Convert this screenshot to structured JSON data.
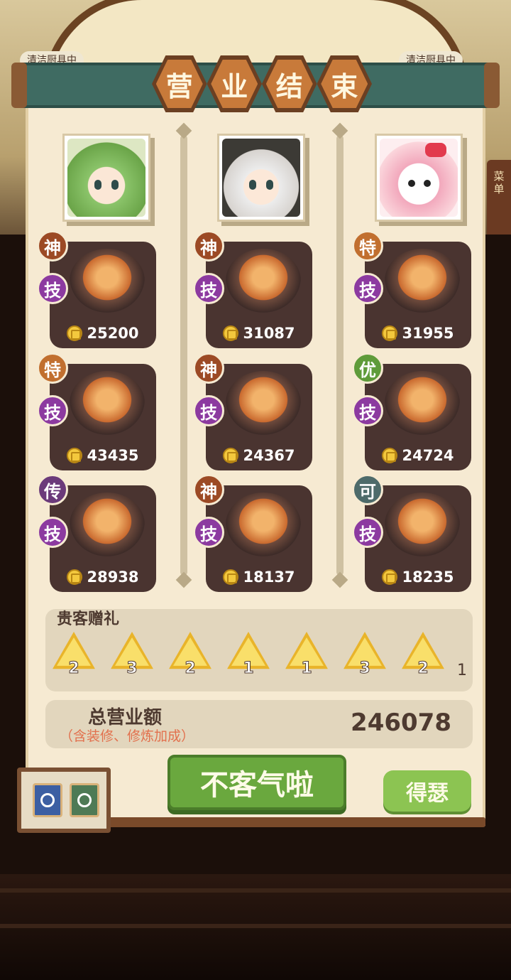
{
  "title_chars": [
    "营",
    "业",
    "结",
    "束"
  ],
  "background": {
    "bubble_left": "清洁厨具中",
    "bubble_right": "清洁厨具中",
    "side_panel": "菜单"
  },
  "customers": [
    {
      "avatar": "green-hair-girl-avatar",
      "dishes": [
        {
          "grade": "神",
          "skill": "技",
          "price": "25200"
        },
        {
          "grade": "特",
          "skill": "技",
          "price": "43435"
        },
        {
          "grade": "传",
          "skill": "技",
          "price": "28938"
        }
      ]
    },
    {
      "avatar": "white-hair-boy-avatar",
      "dishes": [
        {
          "grade": "神",
          "skill": "技",
          "price": "31087"
        },
        {
          "grade": "神",
          "skill": "技",
          "price": "24367"
        },
        {
          "grade": "神",
          "skill": "技",
          "price": "18137"
        }
      ]
    },
    {
      "avatar": "hello-kitty-avatar",
      "dishes": [
        {
          "grade": "特",
          "skill": "技",
          "price": "31955"
        },
        {
          "grade": "优",
          "skill": "技",
          "price": "24724"
        },
        {
          "grade": "可",
          "skill": "技",
          "price": "18235"
        }
      ]
    }
  ],
  "gifts": {
    "title": "贵客赠礼",
    "items": [
      {
        "count": "2"
      },
      {
        "count": "3"
      },
      {
        "count": "2"
      },
      {
        "count": "1"
      },
      {
        "count": "1"
      },
      {
        "count": "3"
      },
      {
        "count": "2"
      }
    ],
    "overflow": "1"
  },
  "total": {
    "label": "总营业额",
    "note": "（含装修、修炼加成）",
    "value": "246078"
  },
  "buttons": {
    "confirm": "不客气啦",
    "share": "得瑟"
  },
  "colors": {
    "confirm_green": "#6aa83e",
    "parchment": "#f6ead2",
    "banner_teal": "#3f6b62"
  }
}
